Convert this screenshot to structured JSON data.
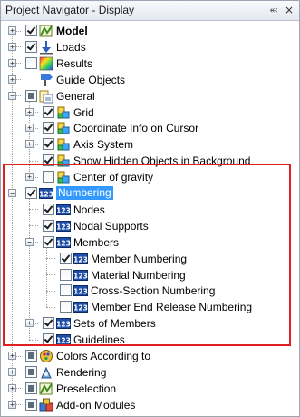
{
  "panel": {
    "title": "Project Navigator - Display",
    "pin_glyph": "⬻",
    "close_glyph": "×"
  },
  "colors": {
    "selection": "#3399ff",
    "highlight_box": "#e02020"
  },
  "tree": [
    {
      "label": "Model",
      "bold": true,
      "state": "checked",
      "icon": "model-icon",
      "expander": "+"
    },
    {
      "label": "Loads",
      "state": "checked",
      "icon": "loads-icon",
      "expander": "+"
    },
    {
      "label": "Results",
      "state": "unchecked",
      "icon": "results-icon",
      "expander": "+"
    },
    {
      "label": "Guide Objects",
      "state": "none",
      "icon": "guide-objects-icon",
      "expander": "+"
    },
    {
      "label": "General",
      "state": "partial",
      "icon": "general-icon",
      "expander": "-"
    },
    {
      "label": "Grid",
      "state": "checked",
      "icon": "grid-icon",
      "expander": "+"
    },
    {
      "label": "Coordinate Info on Cursor",
      "state": "checked",
      "icon": "coordinate-info-icon",
      "expander": "+"
    },
    {
      "label": "Axis System",
      "state": "checked",
      "icon": "axis-system-icon",
      "expander": "+"
    },
    {
      "label": "Show Hidden Objects in Background",
      "state": "checked",
      "icon": "hidden-objects-icon",
      "expander": ""
    },
    {
      "label": "Center of gravity",
      "state": "unchecked",
      "icon": "center-of-gravity-icon",
      "expander": "+"
    },
    {
      "label": "Numbering",
      "state": "checked",
      "icon": "numbering-icon",
      "expander": "-",
      "selected": true
    },
    {
      "label": "Nodes",
      "state": "checked",
      "icon": "numbering-icon",
      "expander": ""
    },
    {
      "label": "Nodal Supports",
      "state": "checked",
      "icon": "numbering-icon",
      "expander": ""
    },
    {
      "label": "Members",
      "state": "checked",
      "icon": "numbering-icon",
      "expander": "-"
    },
    {
      "label": "Member Numbering",
      "state": "checked",
      "icon": "numbering-icon",
      "expander": ""
    },
    {
      "label": "Material Numbering",
      "state": "unchecked",
      "icon": "numbering-icon",
      "expander": ""
    },
    {
      "label": "Cross-Section Numbering",
      "state": "unchecked",
      "icon": "numbering-icon",
      "expander": ""
    },
    {
      "label": "Member End Release Numbering",
      "state": "unchecked",
      "icon": "numbering-icon",
      "expander": ""
    },
    {
      "label": "Sets of Members",
      "state": "checked",
      "icon": "numbering-icon",
      "expander": "+"
    },
    {
      "label": "Guidelines",
      "state": "checked",
      "icon": "numbering-icon",
      "expander": ""
    },
    {
      "label": "Colors According to",
      "state": "partial",
      "icon": "colors-according-icon",
      "expander": "+"
    },
    {
      "label": "Rendering",
      "state": "partial",
      "icon": "rendering-icon",
      "expander": "+"
    },
    {
      "label": "Preselection",
      "state": "partial",
      "icon": "preselection-icon",
      "expander": "+"
    },
    {
      "label": "Add-on Modules",
      "state": "partial",
      "icon": "add-on-modules-icon",
      "expander": "+"
    }
  ],
  "icon_text": {
    "numbering": "123"
  }
}
